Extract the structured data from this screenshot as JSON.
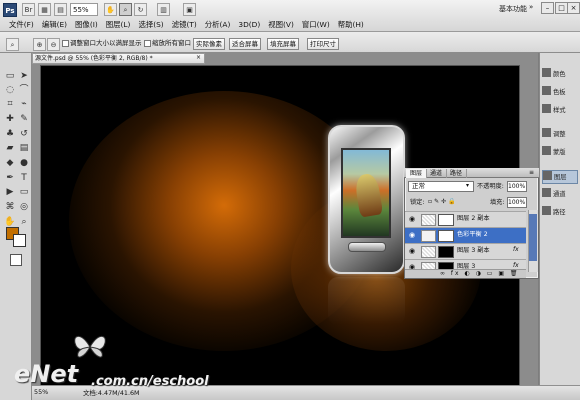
{
  "app": {
    "logo": "Ps",
    "workspace": "基本功能",
    "zoom": "55%"
  },
  "menu": [
    "文件(F)",
    "编辑(E)",
    "图像(I)",
    "图层(L)",
    "选择(S)",
    "滤镜(T)",
    "分析(A)",
    "3D(D)",
    "视图(V)",
    "窗口(W)",
    "帮助(H)"
  ],
  "options": {
    "resize_windows": "调整窗口大小以满屏显示",
    "zoom_all": "缩放所有窗口",
    "actual_pixels": "实际像素",
    "fit_screen": "适合屏幕",
    "fill_screen": "填充屏幕",
    "print_size": "打印尺寸"
  },
  "document": {
    "tab": "源文件.psd @ 55% (色彩平衡 2, RGB/8) *",
    "close": "×"
  },
  "dock": [
    {
      "label": "颜色"
    },
    {
      "label": "色板"
    },
    {
      "label": "样式"
    },
    {
      "label": "调整"
    },
    {
      "label": "蒙版"
    },
    {
      "label": "图层"
    },
    {
      "label": "通道"
    },
    {
      "label": "路径"
    }
  ],
  "layers": {
    "tabs": [
      "图层",
      "通道",
      "路径"
    ],
    "blend": "正常",
    "opacity_label": "不透明度:",
    "opacity": "100%",
    "lock_label": "锁定:",
    "fill_label": "填充:",
    "fill": "100%",
    "rows": [
      {
        "name": "图层 2 副本",
        "selected": false,
        "fx": ""
      },
      {
        "name": "色彩平衡 2",
        "selected": true,
        "fx": ""
      },
      {
        "name": "图层 3 副本",
        "selected": false,
        "fx": "fx"
      },
      {
        "name": "图层 3",
        "selected": false,
        "fx": "fx"
      }
    ],
    "bottom_icons": "∞ fx ◐ ◑ ▭ ▣ 🗑"
  },
  "status": {
    "zoom": "55%",
    "doc": "文档:4.47M/41.6M"
  },
  "watermark": {
    "brand": "eNet",
    "url": ".com.cn/eschool"
  },
  "colors": {
    "foreground": "#c26f00",
    "background": "#ffffff",
    "selected_layer": "#3d6fc5"
  }
}
